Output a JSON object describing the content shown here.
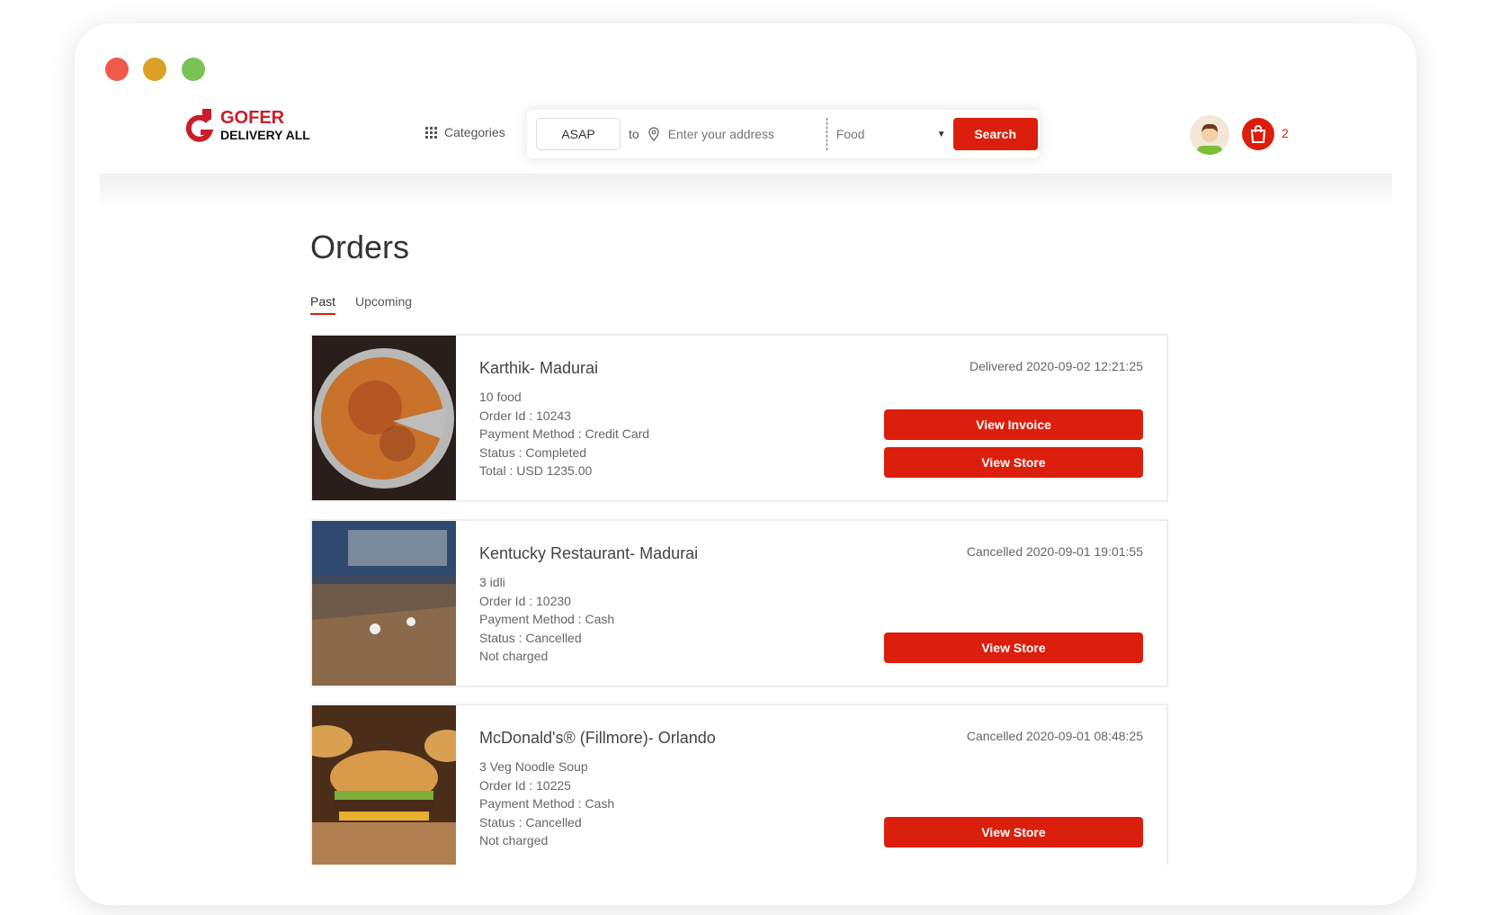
{
  "window": {
    "controls": [
      "close",
      "minimize",
      "maximize"
    ],
    "colors": {
      "close": "#ee5b4a",
      "minimize": "#dca124",
      "maximize": "#7ac256"
    }
  },
  "header": {
    "logo": {
      "line1": "GOFER",
      "line2": "DELIVERY ALL"
    },
    "categories_label": "Categories",
    "search": {
      "time": "ASAP",
      "to_label": "to",
      "address_placeholder": "Enter your address",
      "category": "Food",
      "button": "Search"
    },
    "cart_count": "2"
  },
  "main": {
    "title": "Orders",
    "tabs": [
      {
        "label": "Past",
        "active": true
      },
      {
        "label": "Upcoming",
        "active": false
      }
    ],
    "orders": [
      {
        "store": "Karthik- Madurai",
        "items": "10 food",
        "order_id": "Order Id : 10243",
        "payment": "Payment Method : Credit Card",
        "status": "Status : Completed",
        "total": "Total : USD 1235.00",
        "date": "Delivered 2020-09-02 12:21:25",
        "buttons": [
          "View Invoice",
          "View Store"
        ],
        "image": "pizza"
      },
      {
        "store": "Kentucky Restaurant- Madurai",
        "items": "3 idli",
        "order_id": "Order Id : 10230",
        "payment": "Payment Method : Cash",
        "status": "Status : Cancelled",
        "total": "Not charged",
        "date": "Cancelled 2020-09-01 19:01:55",
        "buttons": [
          "View Store"
        ],
        "image": "restaurant"
      },
      {
        "store": "McDonald's® (Fillmore)- Orlando",
        "items": "3 Veg Noodle Soup",
        "order_id": "Order Id : 10225",
        "payment": "Payment Method : Cash",
        "status": "Status : Cancelled",
        "total": "Not charged",
        "date": "Cancelled 2020-09-01 08:48:25",
        "buttons": [
          "View Store"
        ],
        "image": "burger"
      }
    ]
  },
  "colors": {
    "accent": "#dc1e0c",
    "brand": "#c8202a"
  }
}
